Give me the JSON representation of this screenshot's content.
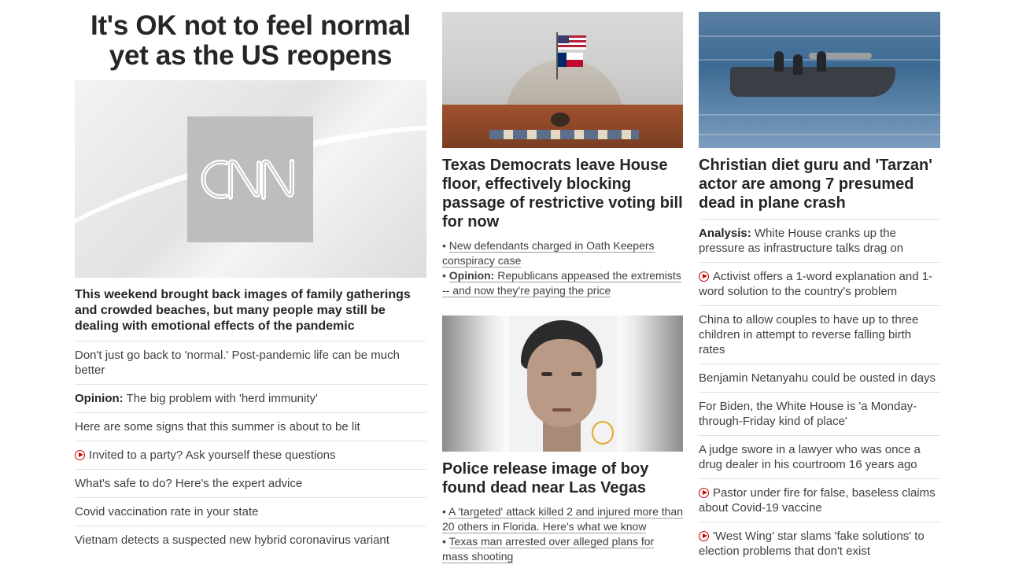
{
  "col1": {
    "headline": "It's OK not to feel normal yet as the US reopens",
    "image_logo": "CNN",
    "subhead": "This weekend brought back images of family gatherings and crowded beaches, but many people may still be dealing with emotional effects of the pandemic",
    "items": [
      {
        "prefix": "",
        "text": "Don't just go back to 'normal.' Post-pandemic life can be much better",
        "video": false
      },
      {
        "prefix": "Opinion:",
        "text": " The big problem with 'herd immunity'",
        "video": false
      },
      {
        "prefix": "",
        "text": "Here are some signs that this summer is about to be lit",
        "video": false
      },
      {
        "prefix": "",
        "text": "Invited to a party? Ask yourself these questions",
        "video": true
      },
      {
        "prefix": "",
        "text": "What's safe to do? Here's the expert advice",
        "video": false
      },
      {
        "prefix": "",
        "text": "Covid vaccination rate in your state",
        "video": false
      },
      {
        "prefix": "",
        "text": "Vietnam detects a suspected new hybrid coronavirus variant",
        "video": false
      }
    ]
  },
  "col2": {
    "story1": {
      "headline": "Texas Democrats leave House floor, effectively blocking passage of restrictive voting bill for now",
      "bullet1": "New defendants charged in Oath Keepers conspiracy case",
      "bullet2_prefix": "Opinion:",
      "bullet2": "Republicans appeased the extremists -- and now they're paying the price"
    },
    "story2": {
      "headline": "Police release image of boy found dead near Las Vegas",
      "bullet1": "A 'targeted' attack killed 2 and injured more than 20 others in Florida. Here's what we know",
      "bullet2": "Texas man arrested over alleged plans for mass shooting"
    }
  },
  "col3": {
    "headline": "Christian diet guru and 'Tarzan' actor are among 7 presumed dead in plane crash",
    "items": [
      {
        "prefix": "Analysis:",
        "text": " White House cranks up the pressure as infrastructure talks drag on",
        "video": false
      },
      {
        "prefix": "",
        "text": "Activist offers a 1-word explanation and 1-word solution to the country's problem",
        "video": true
      },
      {
        "prefix": "",
        "text": "China to allow couples to have up to three children in attempt to reverse falling birth rates",
        "video": false
      },
      {
        "prefix": "",
        "text": "Benjamin Netanyahu could be ousted in days",
        "video": false
      },
      {
        "prefix": "",
        "text": "For Biden, the White House is 'a Monday-through-Friday kind of place'",
        "video": false
      },
      {
        "prefix": "",
        "text": "A judge swore in a lawyer who was once a drug dealer in his courtroom 16 years ago",
        "video": false
      },
      {
        "prefix": "",
        "text": "Pastor under fire for false, baseless claims about Covid-19 vaccine",
        "video": true
      },
      {
        "prefix": "",
        "text": "'West Wing' star slams 'fake solutions' to election problems that don't exist",
        "video": true
      }
    ]
  },
  "colors": {
    "text": "#262626",
    "video_red": "#cc0000",
    "divider": "#e1e1e1"
  }
}
